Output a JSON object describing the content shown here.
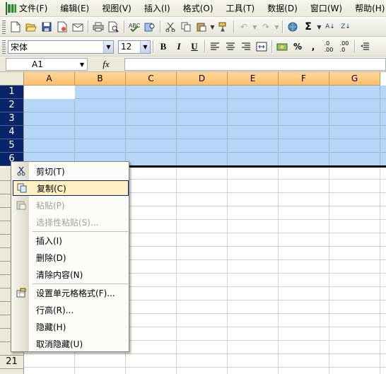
{
  "menubar": {
    "items": [
      "文件(F)",
      "编辑(E)",
      "视图(V)",
      "插入(I)",
      "格式(O)",
      "工具(T)",
      "数据(D)",
      "窗口(W)",
      "帮助(H)"
    ]
  },
  "format_toolbar": {
    "font_name": "宋体",
    "font_size": "12",
    "bold_label": "B",
    "italic_label": "I",
    "underline_label": "U",
    "percent_label": "%",
    "comma_label": ","
  },
  "formula_bar": {
    "name_box": "A1",
    "fx_label": "fx",
    "formula": ""
  },
  "grid": {
    "columns": [
      "A",
      "B",
      "C",
      "D",
      "E",
      "F",
      "G"
    ],
    "selected_rows": [
      "1",
      "2",
      "3",
      "4",
      "5",
      "6"
    ],
    "visible_rows_after_menu": [
      "21"
    ]
  },
  "context_menu": {
    "items": [
      {
        "label": "剪切(T)",
        "icon": "scissors-icon",
        "enabled": true
      },
      {
        "label": "复制(C)",
        "icon": "copy-icon",
        "enabled": true,
        "highlighted": true
      },
      {
        "label": "粘贴(P)",
        "icon": "paste-icon",
        "enabled": false
      },
      {
        "label": "选择性粘贴(S)...",
        "icon": "",
        "enabled": false
      },
      {
        "label": "插入(I)",
        "icon": "",
        "enabled": true
      },
      {
        "label": "删除(D)",
        "icon": "",
        "enabled": true
      },
      {
        "label": "清除内容(N)",
        "icon": "",
        "enabled": true
      },
      {
        "label": "设置单元格格式(F)...",
        "icon": "format-cells-icon",
        "enabled": true
      },
      {
        "label": "行高(R)...",
        "icon": "",
        "enabled": true
      },
      {
        "label": "隐藏(H)",
        "icon": "",
        "enabled": true
      },
      {
        "label": "取消隐藏(U)",
        "icon": "",
        "enabled": true
      }
    ]
  },
  "colors": {
    "selection": "#b6d7f7",
    "row_header_selected": "#0a246a",
    "column_header": "#ffbf6b",
    "menu_highlight": "#fff1c4"
  }
}
